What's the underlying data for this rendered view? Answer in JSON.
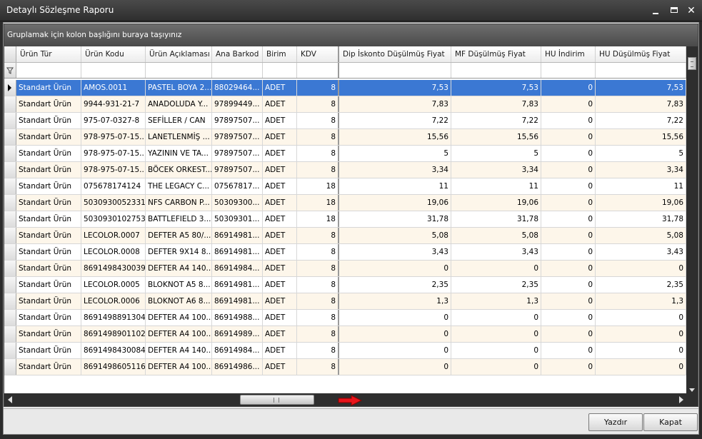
{
  "window": {
    "title": "Detaylı Sözleşme Raporu"
  },
  "grid": {
    "group_panel_text": "Gruplamak için kolon başlığını buraya taşıyınız",
    "columns": [
      "Ürün Tür",
      "Ürün Kodu",
      "Ürün Açıklaması",
      "Ana Barkod",
      "Birim",
      "KDV",
      "Dip İskonto Düşülmüş Fiyat",
      "MF Düşülmüş Fiyat",
      "HU İndirim",
      "HU Düşülmüş Fiyat"
    ],
    "rows": [
      [
        "Standart Ürün",
        "AMOS.0011",
        "PASTEL BOYA 2...",
        "88029464...",
        "ADET",
        "8",
        "7,53",
        "7,53",
        "0",
        "7,53"
      ],
      [
        "Standart Ürün",
        "9944-931-21-7",
        "ANADOLUDA Y...",
        "97899449...",
        "ADET",
        "8",
        "7,83",
        "7,83",
        "0",
        "7,83"
      ],
      [
        "Standart Ürün",
        "975-07-0327-8",
        "SEFİLLER / CAN",
        "97897507...",
        "ADET",
        "8",
        "7,22",
        "7,22",
        "0",
        "7,22"
      ],
      [
        "Standart Ürün",
        "978-975-07-15...",
        "LANETLENMİŞ ...",
        "97897507...",
        "ADET",
        "8",
        "15,56",
        "15,56",
        "0",
        "15,56"
      ],
      [
        "Standart Ürün",
        "978-975-07-15...",
        "YAZININ VE TA...",
        "97897507...",
        "ADET",
        "8",
        "5",
        "5",
        "0",
        "5"
      ],
      [
        "Standart Ürün",
        "978-975-07-15...",
        "BÖCEK ORKEST...",
        "97897507...",
        "ADET",
        "8",
        "3,34",
        "3,34",
        "0",
        "3,34"
      ],
      [
        "Standart Ürün",
        "075678174124",
        "THE LEGACY C...",
        "07567817...",
        "ADET",
        "18",
        "11",
        "11",
        "0",
        "11"
      ],
      [
        "Standart Ürün",
        "5030930052331",
        "NFS CARBON P...",
        "50309300...",
        "ADET",
        "18",
        "19,06",
        "19,06",
        "0",
        "19,06"
      ],
      [
        "Standart Ürün",
        "5030930102753",
        "BATTLEFIELD 3...",
        "50309301...",
        "ADET",
        "18",
        "31,78",
        "31,78",
        "0",
        "31,78"
      ],
      [
        "Standart Ürün",
        "LECOLOR.0007",
        "DEFTER A5 80/...",
        "86914981...",
        "ADET",
        "8",
        "5,08",
        "5,08",
        "0",
        "5,08"
      ],
      [
        "Standart Ürün",
        "LECOLOR.0008",
        "DEFTER 9X14 8...",
        "86914981...",
        "ADET",
        "8",
        "3,43",
        "3,43",
        "0",
        "3,43"
      ],
      [
        "Standart Ürün",
        "8691498430039",
        "DEFTER A4 140...",
        "86914984...",
        "ADET",
        "8",
        "0",
        "0",
        "0",
        "0"
      ],
      [
        "Standart Ürün",
        "LECOLOR.0005",
        "BLOKNOT A5 8...",
        "86914981...",
        "ADET",
        "8",
        "2,35",
        "2,35",
        "0",
        "2,35"
      ],
      [
        "Standart Ürün",
        "LECOLOR.0006",
        "BLOKNOT A6 8...",
        "86914981...",
        "ADET",
        "8",
        "1,3",
        "1,3",
        "0",
        "1,3"
      ],
      [
        "Standart Ürün",
        "8691498891304",
        "DEFTER A4 100...",
        "86914988...",
        "ADET",
        "8",
        "0",
        "0",
        "0",
        "0"
      ],
      [
        "Standart Ürün",
        "8691498901102",
        "DEFTER A4 100...",
        "86914989...",
        "ADET",
        "8",
        "0",
        "0",
        "0",
        "0"
      ],
      [
        "Standart Ürün",
        "8691498430084",
        "DEFTER A4 140...",
        "86914984...",
        "ADET",
        "8",
        "0",
        "0",
        "0",
        "0"
      ],
      [
        "Standart Ürün",
        "8691498605116",
        "DEFTER A4 100...",
        "86914986...",
        "ADET",
        "8",
        "0",
        "0",
        "0",
        "0"
      ]
    ],
    "selected_row": 0
  },
  "buttons": {
    "print": "Yazdır",
    "close": "Kapat"
  },
  "colors": {
    "selection": "#3b78d3",
    "alt_row": "#fdf6ea",
    "arrow": "#e8141b"
  },
  "icons": {
    "filter": "filter-icon",
    "row_pointer": "row-pointer-icon",
    "scroll_hint": "red-arrow-icon"
  }
}
